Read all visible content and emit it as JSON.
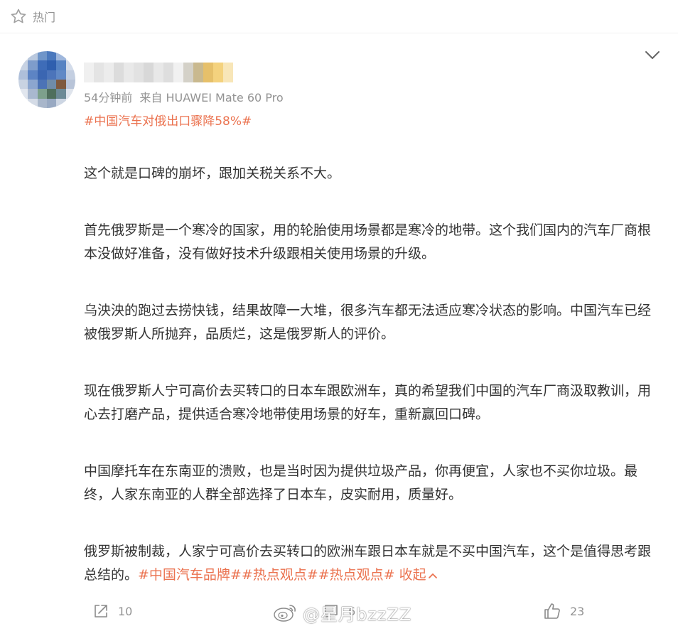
{
  "header": {
    "section_label": "热门"
  },
  "post": {
    "meta_time": "54分钟前",
    "meta_source": "来自 HUAWEI Mate 60 Pro",
    "topic": "#中国汽车对俄出口骤降58%#",
    "paragraphs": [
      "这个就是口碑的崩坏，跟加关税关系不大。",
      "首先俄罗斯是一个寒冷的国家，用的轮胎使用场景都是寒冷的地带。这个我们国内的汽车厂商根本没做好准备，没有做好技术升级跟相关使用场景的升级。",
      "乌泱泱的跑过去捞快钱，结果故障一大堆，很多汽车都无法适应寒冷状态的影响。中国汽车已经被俄罗斯人所抛弃，品质烂，这是俄罗斯人的评价。",
      "现在俄罗斯人宁可高价去买转口的日本车跟欧洲车，真的希望我们中国的汽车厂商汲取教训，用心去打磨产品，提供适合寒冷地带使用场景的好车，重新赢回口碑。",
      "中国摩托车在东南亚的溃败，也是当时因为提供垃圾产品，你再便宜，人家也不买你垃圾。最终，人家东南亚的人群全部选择了日本车，皮实耐用，质量好。"
    ],
    "last_paragraph_text": "俄罗斯被制裁，人家宁可高价去买转口的欧洲车跟日本车就是不买中国汽车，这个是值得思考跟总结的。",
    "tags": [
      "#中国汽车品牌#",
      "#热点观点#",
      "#热点观点#"
    ],
    "collapse_label": "收起",
    "actions": {
      "repost_count": "10",
      "comment_count": "6",
      "like_count": "23"
    },
    "watermark": "@星月bzzZZ"
  },
  "colors": {
    "accent": "#eb7350",
    "muted": "#939393",
    "text": "#333333"
  },
  "icons": [
    "star-icon",
    "chevron-down-icon",
    "share-icon",
    "comment-icon",
    "like-icon",
    "weibo-logo-icon"
  ]
}
